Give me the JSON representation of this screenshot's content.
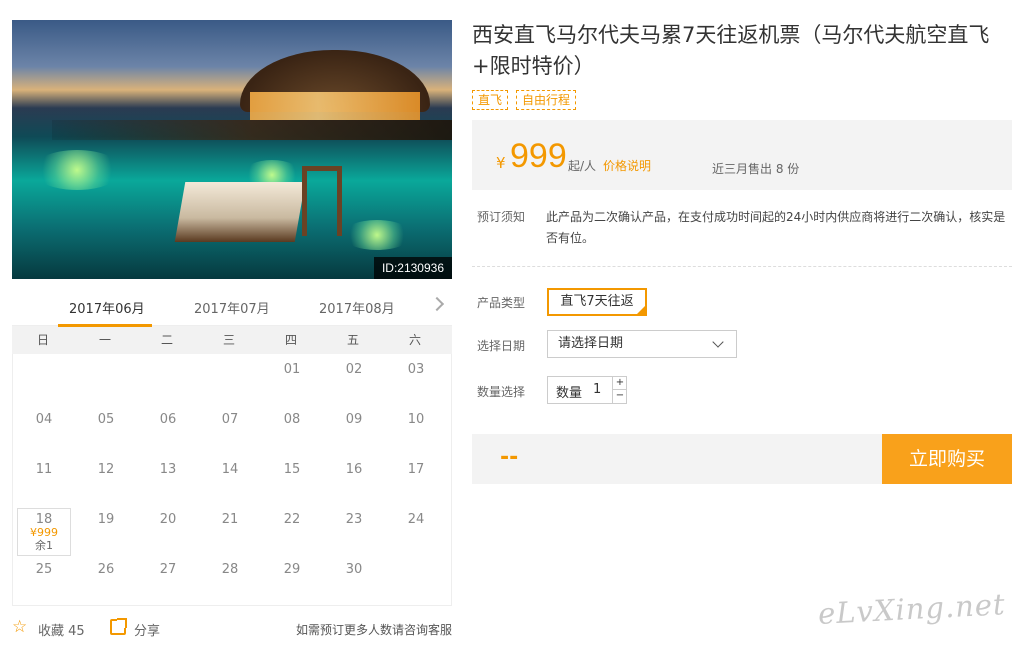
{
  "product": {
    "image_id": "ID:2130936",
    "title": "西安直飞马尔代夫马累7天往返机票（马尔代夫航空直飞+限时特价）",
    "tags": [
      "直飞",
      "自由行程"
    ]
  },
  "calendar": {
    "months": [
      "2017年06月",
      "2017年07月",
      "2017年08月"
    ],
    "weekdays": [
      "日",
      "一",
      "二",
      "三",
      "四",
      "五",
      "六"
    ],
    "selected": {
      "day": "18",
      "price": "¥999",
      "stock": "余1"
    }
  },
  "actions": {
    "favorite_label": "收藏",
    "favorite_count": "45",
    "share_label": "分享",
    "note": "如需预订更多人数请咨询客服"
  },
  "price": {
    "currency": "¥",
    "amount": "999",
    "unit": "起/人",
    "explain_link": "价格说明",
    "sold": "近三月售出 8 份"
  },
  "booking": {
    "notice_label": "预订须知",
    "notice_text": "此产品为二次确认产品，在支付成功时间起的24小时内供应商将进行二次确认，核实是否有位。",
    "type_label": "产品类型",
    "type_value": "直飞7天往返",
    "date_label": "选择日期",
    "date_placeholder": "请选择日期",
    "qty_label": "数量选择",
    "qty_inner_label": "数量",
    "qty_value": "1",
    "qty_up": "+",
    "qty_down": "−",
    "total": "--",
    "buy_label": "立即购买"
  },
  "watermark": "eLvXing.net",
  "colors": {
    "accent": "#f39800",
    "buy_button": "#f9a11b"
  }
}
